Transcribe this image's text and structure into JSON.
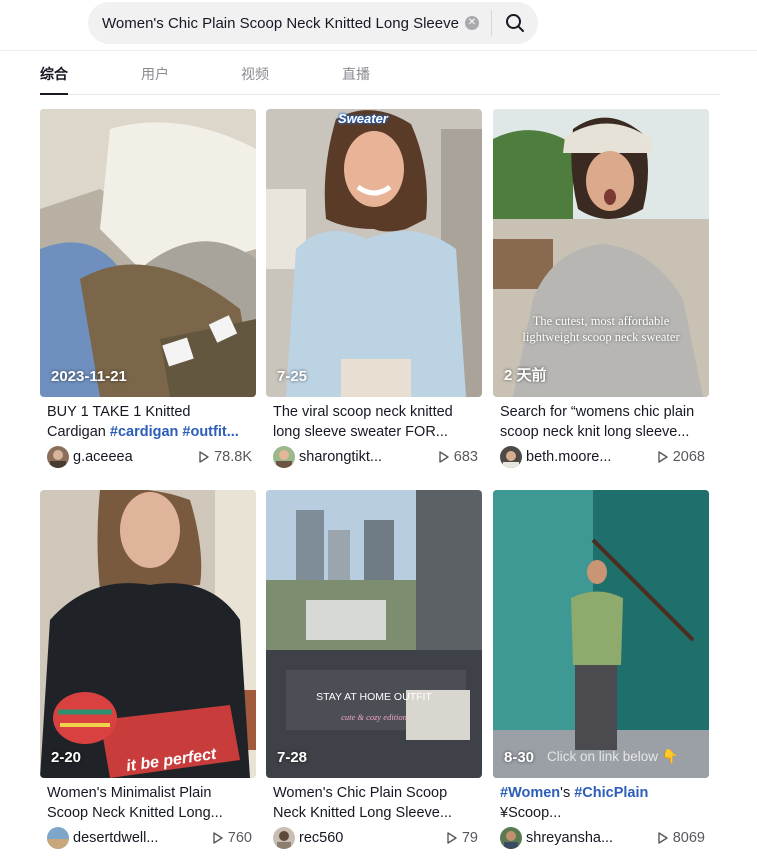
{
  "search": {
    "value": "Women's Chic Plain Scoop Neck Knitted Long Sleeve",
    "clear_glyph": "✕",
    "icons": [
      "search-icon",
      "clear-icon"
    ]
  },
  "tabs": [
    {
      "label": "综合",
      "active": true
    },
    {
      "label": "用户",
      "active": false
    },
    {
      "label": "视频",
      "active": false
    },
    {
      "label": "直播",
      "active": false
    }
  ],
  "videos": [
    {
      "date": "2023-11-21",
      "desc_pre": "BUY 1 TAKE 1 Knitted Cardigan ",
      "tags": [
        "#cardigan",
        "#outfit..."
      ],
      "desc_post": "",
      "author": "g.aceeea",
      "plays": "78.8K"
    },
    {
      "date": "7-25",
      "desc_pre": "The viral scoop neck knitted long sleeve sweater FOR...",
      "tags": [],
      "desc_post": "",
      "author": "sharongtikt...",
      "plays": "683",
      "overlay": "Sweater"
    },
    {
      "date": "2 天前",
      "desc_pre": "Search for “womens chic plain scoop neck knit long sleeve...",
      "tags": [],
      "desc_post": "",
      "author": "beth.moore...",
      "plays": "2068",
      "overlay": "The cutest, most affordable lightweight scoop neck sweater"
    },
    {
      "date": "2-20",
      "desc_pre": "Women's Minimalist Plain Scoop Neck Knitted Long...",
      "tags": [],
      "desc_post": "",
      "author": "desertdwell...",
      "plays": "760",
      "overlay": "it be perfect"
    },
    {
      "date": "7-28",
      "desc_pre": "Women's Chic Plain Scoop Neck Knitted Long Sleeve...",
      "tags": [],
      "desc_post": "",
      "author": "rec560",
      "plays": "79",
      "overlay": "STAY AT HOME OUTFIT",
      "overlay2": "cute & cozy edition"
    },
    {
      "date": "8-30",
      "desc_pre": "",
      "tags": [
        "#Women"
      ],
      "desc_mid": "'s ",
      "tags2": [
        "#ChicPlain"
      ],
      "desc_post": " ¥Scoop...",
      "author": "shreyansha...",
      "plays": "8069",
      "overlay": "Click on link below 👇"
    }
  ],
  "colors": {
    "accent_tag": "#2b5db9",
    "text": "#161823",
    "muted": "#8a8b91"
  }
}
